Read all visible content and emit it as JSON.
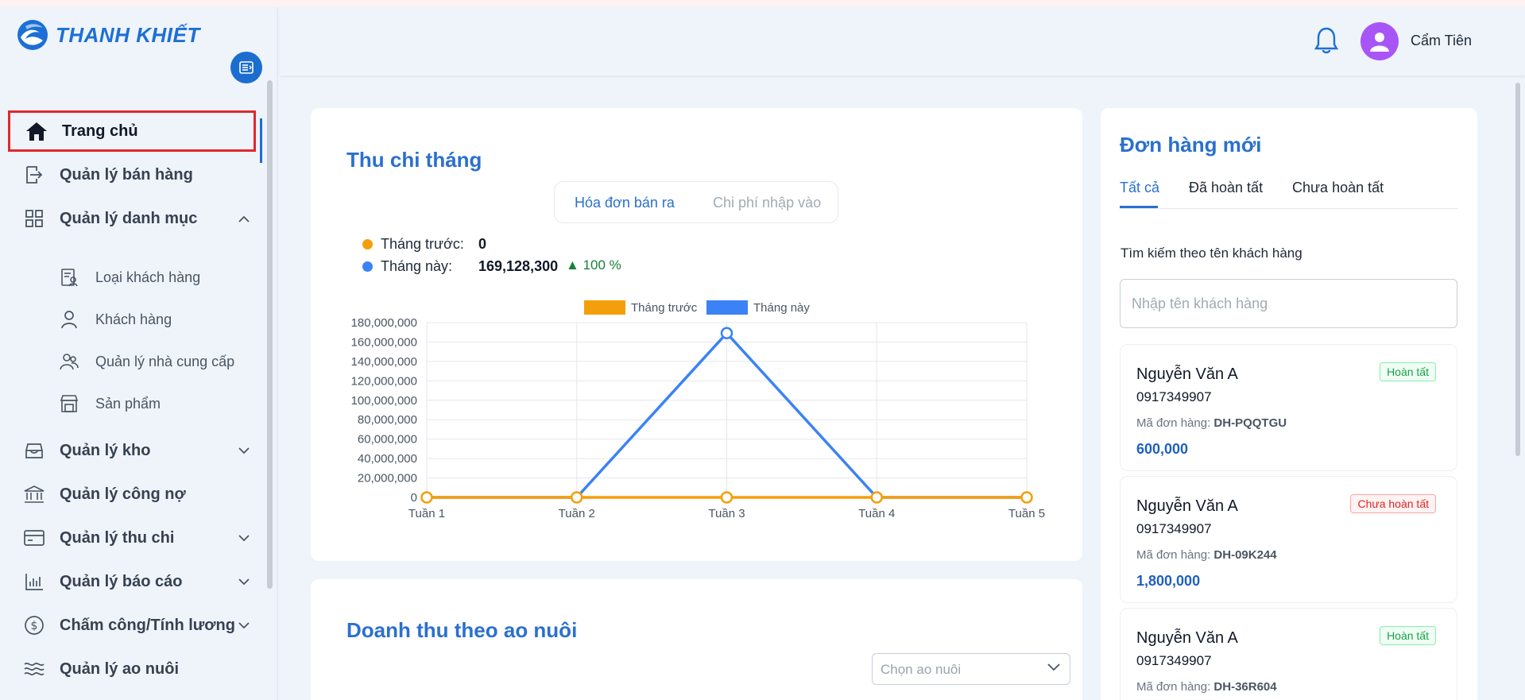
{
  "brand": {
    "name": "THANH KHIẾT"
  },
  "header": {
    "user_name": "Cẩm Tiên"
  },
  "sidebar": {
    "items": [
      {
        "label": "Trang chủ",
        "icon": "home-icon"
      },
      {
        "label": "Quản lý bán hàng",
        "icon": "sales-icon"
      },
      {
        "label": "Quản lý danh mục",
        "icon": "grid-icon"
      },
      {
        "label": "Quản lý kho",
        "icon": "warehouse-icon"
      },
      {
        "label": "Quản lý công nợ",
        "icon": "bank-icon"
      },
      {
        "label": "Quản lý thu chi",
        "icon": "wallet-icon"
      },
      {
        "label": "Quản lý báo cáo",
        "icon": "bar-chart-icon"
      },
      {
        "label": "Chấm công/Tính lương",
        "icon": "dollar-icon"
      },
      {
        "label": "Quản lý ao nuôi",
        "icon": "waves-icon"
      }
    ],
    "sub_items": [
      {
        "label": "Loại khách hàng",
        "icon": "customer-type-icon"
      },
      {
        "label": "Khách hàng",
        "icon": "user-icon"
      },
      {
        "label": "Quản lý nhà cung cấp",
        "icon": "suppliers-icon"
      },
      {
        "label": "Sản phẩm",
        "icon": "store-icon"
      }
    ]
  },
  "monthly": {
    "title": "Thu chi tháng",
    "tabs": [
      "Hóa đơn bán ra",
      "Chi phí nhập vào"
    ],
    "prev_label": "Tháng trước:",
    "prev_value": "0",
    "curr_label": "Tháng này:",
    "curr_value": "169,128,300",
    "change": "100 %",
    "colors": {
      "prev": "#f59e0b",
      "curr": "#3b82f6",
      "up": "#15803d"
    }
  },
  "revenue": {
    "title": "Doanh thu theo ao nuôi",
    "select_placeholder": "Chọn ao nuôi"
  },
  "orders": {
    "title": "Đơn hàng mới",
    "tabs": [
      "Tất cả",
      "Đã hoàn tất",
      "Chưa hoàn tất"
    ],
    "search_label": "Tìm kiếm theo tên khách hàng",
    "search_placeholder": "Nhập tên khách hàng",
    "code_label": "Mã đơn hàng:",
    "list": [
      {
        "name": "Nguyễn Văn A",
        "phone": "0917349907",
        "code": "DH-PQQTGU",
        "amount": "600,000",
        "status": "Hoàn tất"
      },
      {
        "name": "Nguyễn Văn A",
        "phone": "0917349907",
        "code": "DH-09K244",
        "amount": "1,800,000",
        "status": "Chưa hoàn tất"
      },
      {
        "name": "Nguyễn Văn A",
        "phone": "0917349907",
        "code": "DH-36R604",
        "amount": "",
        "status": "Hoàn tất"
      }
    ]
  },
  "chart_data": {
    "type": "line",
    "categories": [
      "Tuần 1",
      "Tuần 2",
      "Tuần 3",
      "Tuần 4",
      "Tuần 5"
    ],
    "series": [
      {
        "name": "Tháng trước",
        "values": [
          0,
          0,
          0,
          0,
          0
        ],
        "color": "#f59e0b"
      },
      {
        "name": "Tháng này",
        "values": [
          0,
          0,
          169128300,
          0,
          0
        ],
        "color": "#3b82f6"
      }
    ],
    "y_ticks": [
      "0",
      "20,000,000",
      "40,000,000",
      "60,000,000",
      "80,000,000",
      "100,000,000",
      "120,000,000",
      "140,000,000",
      "160,000,000",
      "180,000,000"
    ],
    "ylim": [
      0,
      180000000
    ],
    "grid": true,
    "legend": "top-center"
  }
}
